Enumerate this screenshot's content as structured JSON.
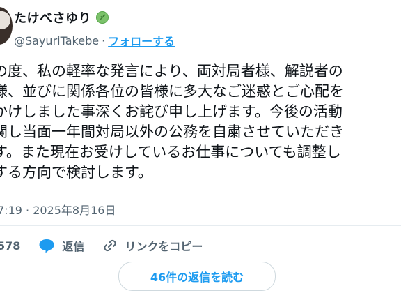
{
  "author": {
    "display_name": "たけべさゆり",
    "handle": "@SayuriTakebe",
    "separator": "·",
    "follow_label": "フォローする"
  },
  "tweet": {
    "lines": [
      "の度、私の軽率な発言により、両対局者様、解説者の",
      "様、並びに関係各位の皆様に多大なご迷惑とご心配を",
      "かけしました事深くお詫び申し上げます。今後の活動",
      "関し当面一年間対局以外の公務を自粛させていただき",
      "す。また現在お受けしているお仕事についても調整し",
      "する方向で検討します。"
    ],
    "timestamp": "7:19 · 2025年8月16日"
  },
  "actions": {
    "likes_count": "578",
    "reply_label": "返信",
    "copy_link_label": "リンクをコピー"
  },
  "more_replies_label": "46件の返信を読む",
  "colors": {
    "accent": "#1d9bf0",
    "secondary_text": "#536471",
    "heart": "#f91880",
    "leaf": "#57a64a"
  }
}
